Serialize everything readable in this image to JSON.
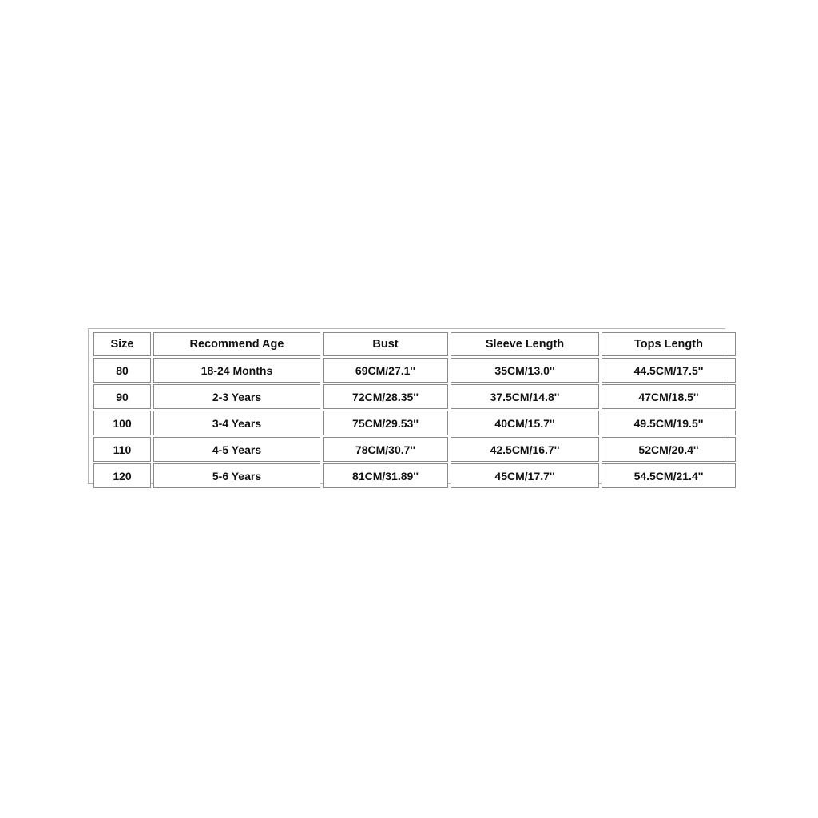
{
  "size_chart": {
    "columns": [
      "Size",
      "Recommend Age",
      "Bust",
      "Sleeve Length",
      "Tops Length"
    ],
    "rows": [
      [
        "80",
        "18-24 Months",
        "69CM/27.1''",
        "35CM/13.0''",
        "44.5CM/17.5''"
      ],
      [
        "90",
        "2-3 Years",
        "72CM/28.35''",
        "37.5CM/14.8''",
        "47CM/18.5''"
      ],
      [
        "100",
        "3-4 Years",
        "75CM/29.53''",
        "40CM/15.7''",
        "49.5CM/19.5''"
      ],
      [
        "110",
        "4-5 Years",
        "78CM/30.7''",
        "42.5CM/16.7''",
        "52CM/20.4''"
      ],
      [
        "120",
        "5-6 Years",
        "81CM/31.89''",
        "45CM/17.7''",
        "54.5CM/21.4''"
      ]
    ]
  },
  "colors": {
    "page_background": "#ffffff",
    "cell_background": "#ffffff",
    "cell_border": "#8a8a8a",
    "outer_border": "#b5b5b5",
    "text": "#111111"
  }
}
